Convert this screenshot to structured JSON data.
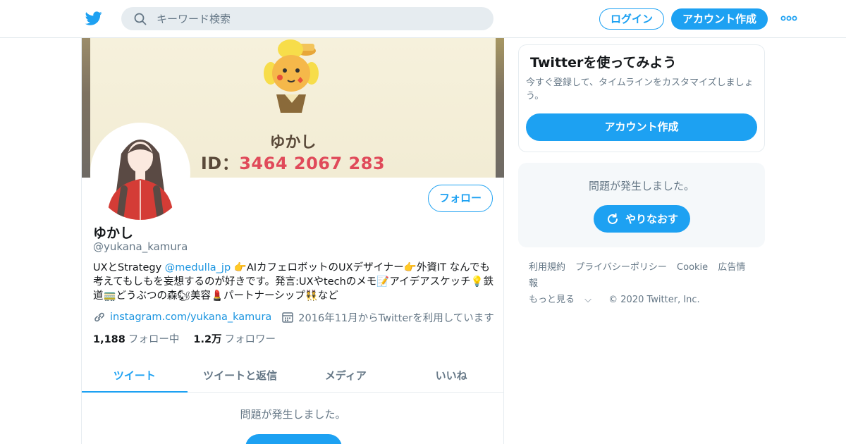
{
  "header": {
    "search_placeholder": "キーワード検索",
    "login_label": "ログイン",
    "signup_label": "アカウント作成",
    "logo_icon": "twitter-bird-icon",
    "more_icon": "more-dots-icon",
    "accent": "#1da1f2"
  },
  "profile": {
    "banner_name": "ゆかし",
    "banner_id_prefix": "ID：",
    "banner_id_number": "3464 2067 283",
    "follow_label": "フォロー",
    "name": "ゆかし",
    "handle": "@yukana_kamura",
    "bio_part1": "UXとStrategy  ",
    "bio_mention": "@medulla_jp",
    "bio_part2": " 👉AIカフェロボットのUXデザイナー👉外資IT  なんでも考えてもしもを妄想するのが好きです。発言:UXやtechのメモ📝アイデアスケッチ💡鉄道🚃どうぶつの森🐿美容💄パートナーシップ👯など",
    "website": "instagram.com/yukana_kamura",
    "joined": "2016年11月からTwitterを利用しています",
    "following_count": "1,188",
    "following_label": "フォロー中",
    "followers_count": "1.2万",
    "followers_label": "フォロワー"
  },
  "tabs": [
    {
      "label": "ツイート",
      "active": true
    },
    {
      "label": "ツイートと返信",
      "active": false
    },
    {
      "label": "メディア",
      "active": false
    },
    {
      "label": "いいね",
      "active": false
    }
  ],
  "timeline": {
    "error": "問題が発生しました。"
  },
  "sidebar": {
    "signup_card": {
      "title": "Twitterを使ってみよう",
      "desc": "今すぐ登録して、タイムラインをカスタマイズしましょう。",
      "cta": "アカウント作成"
    },
    "error_card": {
      "message": "問題が発生しました。",
      "retry_label": "やりなおす"
    },
    "footer": {
      "links": [
        "利用規約",
        "プライバシーポリシー",
        "Cookie",
        "広告情報"
      ],
      "more": "もっと見る",
      "copyright": "© 2020 Twitter, Inc."
    }
  }
}
